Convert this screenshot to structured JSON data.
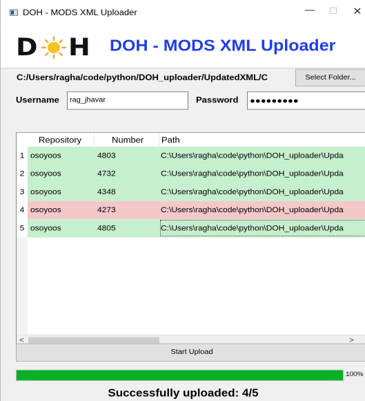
{
  "window": {
    "title": "DOH - MODS XML Uploader",
    "controls": {
      "minimize": "—",
      "maximize": "☐",
      "close": "✕"
    }
  },
  "header": {
    "logo": {
      "left": "D",
      "right": "H"
    },
    "title": "DOH - MODS XML Uploader",
    "title_color": "#1f3ee8"
  },
  "folder": {
    "path": "C:/Users/ragha/code/python/DOH_uploader/UpdatedXML/C",
    "select_label": "Select Folder..."
  },
  "credentials": {
    "username_label": "Username",
    "username_value": "rag_jhavar",
    "password_label": "Password",
    "password_mask": "●●●●●●●●●"
  },
  "table": {
    "columns": [
      "Repository",
      "Number",
      "Path"
    ],
    "rows": [
      {
        "index": "1",
        "repository": "osoyoos",
        "number": "4803",
        "path": "C:\\Users\\ragha\\code\\python\\DOH_uploader\\Upda",
        "status": "ok"
      },
      {
        "index": "2",
        "repository": "osoyoos",
        "number": "4732",
        "path": "C:\\Users\\ragha\\code\\python\\DOH_uploader\\Upda",
        "status": "ok"
      },
      {
        "index": "3",
        "repository": "osoyoos",
        "number": "4348",
        "path": "C:\\Users\\ragha\\code\\python\\DOH_uploader\\Upda",
        "status": "ok"
      },
      {
        "index": "4",
        "repository": "osoyoos",
        "number": "4273",
        "path": "C:\\Users\\ragha\\code\\python\\DOH_uploader\\Upda",
        "status": "fail"
      },
      {
        "index": "5",
        "repository": "osoyoos",
        "number": "4805",
        "path": "C:\\Users\\ragha\\code\\python\\DOH_uploader\\Upda",
        "status": "ok"
      }
    ],
    "colors": {
      "ok": "#c6efce",
      "fail": "#f4c8c9"
    }
  },
  "upload": {
    "button_label": "Start Upload",
    "progress": 1.0,
    "progress_text": "100%",
    "progress_color": "#06b025",
    "status_text": "Successfully uploaded: 4/5"
  }
}
